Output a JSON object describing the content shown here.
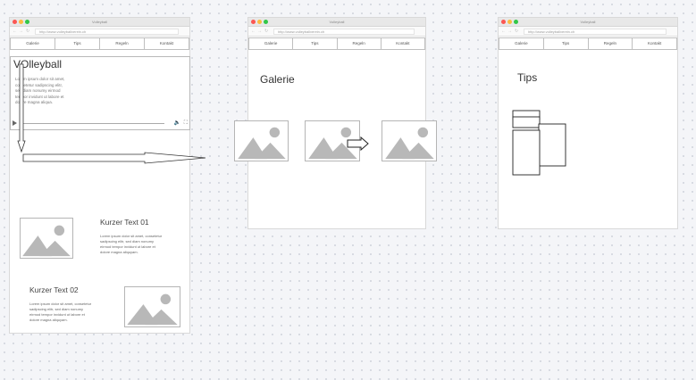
{
  "window_title": "Volleyball",
  "url": "http://www.volleyballverein.ch",
  "nav_tabs": [
    "Galerie",
    "Tips",
    "Regeln",
    "Kontakt"
  ],
  "home": {
    "video_title": "VOlleyball",
    "video_text": "Lorem ipsum dolor sit amet, consetetur sadipscing elitr, sed diam nonumy eirmod tempor invidunt ut labore et dolore magna aliqua.",
    "text1_title": "Kurzer Text 01",
    "text1_body": "Lorem ipsum dolor sit amet, consetetur sadipscing elitr, sed diam nonumy eirmod tempor invidunt ut labore et dolore magna aliquyam.",
    "text2_title": "Kurzer Text 02",
    "text2_body": "Lorem ipsum dolor sit amet, consetetur sadipscing elitr, sed diam nonumy eirmod tempor invidunt ut labore et dolore magna aliquyam."
  },
  "gallery": {
    "heading": "Galerie"
  },
  "tips": {
    "heading": "Tips"
  },
  "colors": {
    "traffic_red": "#fc5753",
    "traffic_yellow": "#fdbc40",
    "traffic_green": "#33c748",
    "image_placeholder": "#b8b8b8"
  }
}
